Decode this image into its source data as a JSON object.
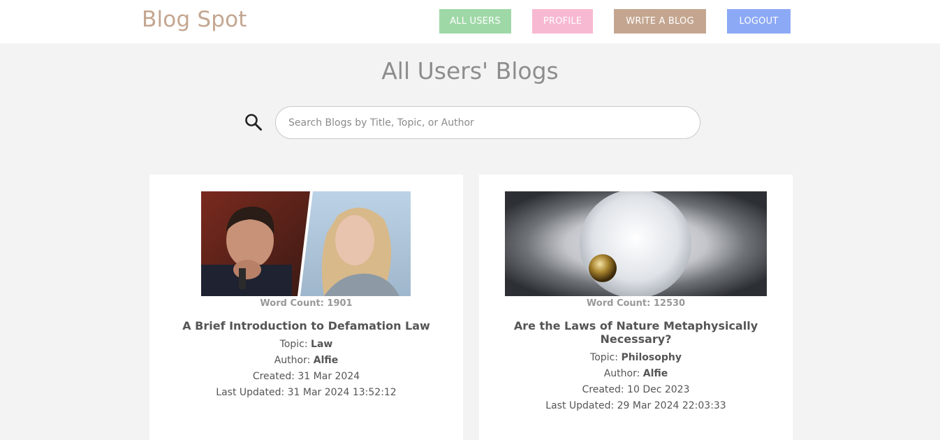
{
  "header": {
    "brand": "Blog Spot",
    "nav": {
      "all_users": "ALL USERS",
      "profile": "PROFILE",
      "write_blog": "WRITE A BLOG",
      "logout": "LOGOUT"
    }
  },
  "main": {
    "title": "All Users' Blogs",
    "search": {
      "placeholder": "Search Blogs by Title, Topic, or Author",
      "value": ""
    }
  },
  "blogs": [
    {
      "word_count": "Word Count: 1901",
      "title": "A Brief Introduction to Defamation Law",
      "topic_label": "Topic:",
      "topic": "Law",
      "author_label": "Author:",
      "author": "Alfie",
      "created": "Created: 31 Mar 2024",
      "updated": "Last Updated: 31 Mar 2024 13:52:12"
    },
    {
      "word_count": "Word Count: 12530",
      "title": "Are the Laws of Nature Metaphysically Necessary?",
      "topic_label": "Topic:",
      "topic": "Philosophy",
      "author_label": "Author:",
      "author": "Alfie",
      "created": "Created: 10 Dec 2023",
      "updated": "Last Updated: 29 Mar 2024 22:03:33"
    }
  ],
  "icons": {
    "search": "search-icon"
  },
  "colors": {
    "brand": "#c4a690",
    "all_users": "#9fd8a7",
    "profile": "#f7b9d1",
    "write_blog": "#c4a690",
    "logout": "#8ca9f5",
    "background": "#f3f3f3"
  }
}
